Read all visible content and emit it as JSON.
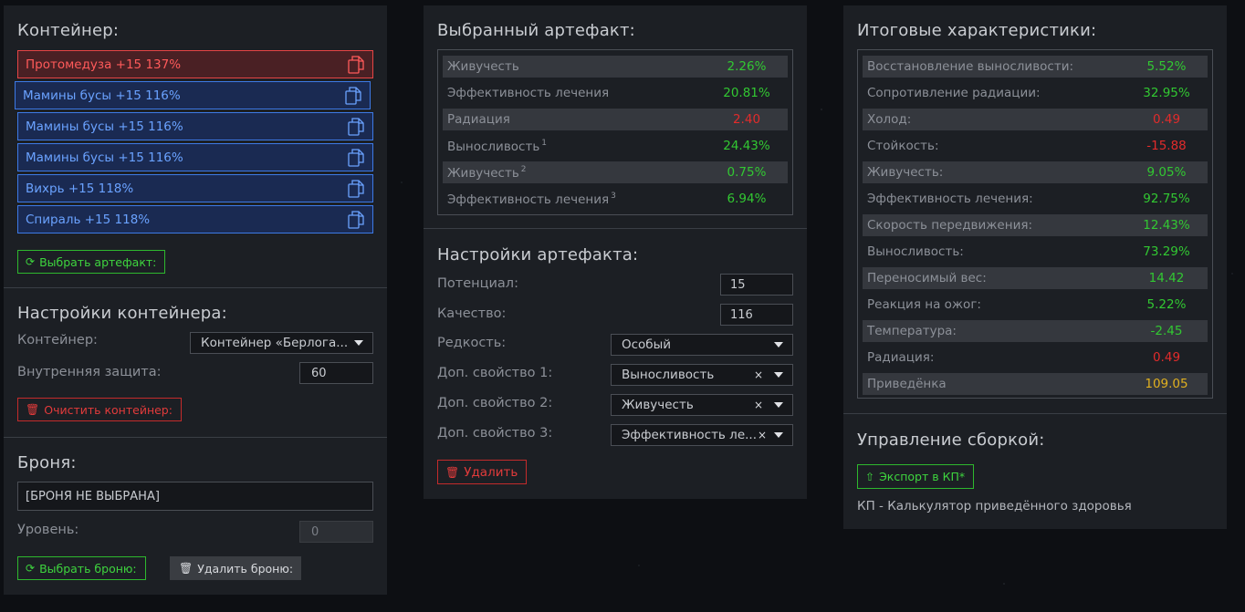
{
  "container_panel": {
    "title": "Контейнер:",
    "artifacts": [
      {
        "label": "Протомедуза +15 137%",
        "style": "red"
      },
      {
        "label": "Мамины бусы +15 116%",
        "style": "blue"
      },
      {
        "label": "Мамины бусы +15 116%",
        "style": "blue"
      },
      {
        "label": "Мамины бусы +15 116%",
        "style": "blue"
      },
      {
        "label": "Вихрь +15 118%",
        "style": "blue"
      },
      {
        "label": "Спираль +15 118%",
        "style": "blue"
      }
    ],
    "select_artifact_label": "Выбрать артефакт:",
    "settings_title": "Настройки контейнера:",
    "container_label": "Контейнер:",
    "container_value": "Контейнер «Берлога...",
    "inner_protection_label": "Внутренняя защита:",
    "inner_protection_value": "60",
    "clear_label": "Очистить контейнер:",
    "armor_title": "Броня:",
    "armor_value": "[БРОНЯ НЕ ВЫБРАНА]",
    "level_label": "Уровень:",
    "level_value": "0",
    "select_armor_label": "Выбрать броню:",
    "delete_armor_label": "Удалить броню:"
  },
  "artifact_panel": {
    "title": "Выбранный артефакт:",
    "stats": [
      {
        "name": "Живучесть",
        "sup": "",
        "value": "2.26%",
        "color": "green"
      },
      {
        "name": "Эффективность лечения",
        "sup": "",
        "value": "20.81%",
        "color": "green"
      },
      {
        "name": "Радиация",
        "sup": "",
        "value": "2.40",
        "color": "red"
      },
      {
        "name": "Выносливость",
        "sup": "1",
        "value": "24.43%",
        "color": "green"
      },
      {
        "name": "Живучесть",
        "sup": "2",
        "value": "0.75%",
        "color": "green"
      },
      {
        "name": "Эффективность лечения",
        "sup": "3",
        "value": "6.94%",
        "color": "green"
      }
    ],
    "settings_title": "Настройки артефакта:",
    "potential_label": "Потенциал:",
    "potential_value": "15",
    "quality_label": "Качество:",
    "quality_value": "116",
    "rarity_label": "Редкость:",
    "rarity_value": "Особый",
    "prop1_label": "Доп. свойство 1:",
    "prop1_value": "Выносливость",
    "prop2_label": "Доп. свойство 2:",
    "prop2_value": "Живучесть",
    "prop3_label": "Доп. свойство 3:",
    "prop3_value": "Эффективность ле...",
    "clear_x": "×",
    "delete_label": "Удалить"
  },
  "totals_panel": {
    "title": "Итоговые характеристики:",
    "stats": [
      {
        "name": "Восстановление выносливости:",
        "value": "5.52%",
        "color": "green"
      },
      {
        "name": "Сопротивление радиации:",
        "value": "32.95%",
        "color": "green"
      },
      {
        "name": "Холод:",
        "value": "0.49",
        "color": "red"
      },
      {
        "name": "Стойкость:",
        "value": "-15.88",
        "color": "red"
      },
      {
        "name": "Живучесть:",
        "value": "9.05%",
        "color": "green"
      },
      {
        "name": "Эффективность лечения:",
        "value": "92.75%",
        "color": "green"
      },
      {
        "name": "Скорость передвижения:",
        "value": "12.43%",
        "color": "green"
      },
      {
        "name": "Выносливость:",
        "value": "73.29%",
        "color": "green"
      },
      {
        "name": "Переносимый вес:",
        "value": "14.42",
        "color": "green"
      },
      {
        "name": "Реакция на ожог:",
        "value": "5.22%",
        "color": "green"
      },
      {
        "name": "Температура:",
        "value": "-2.45",
        "color": "green"
      },
      {
        "name": "Радиация:",
        "value": "0.49",
        "color": "red"
      },
      {
        "name": "Приведёнка",
        "value": "109.05",
        "color": "yellow"
      }
    ],
    "build_title": "Управление сборкой:",
    "export_label": "Экспорт в КП*",
    "footnote": "КП - Калькулятор приведённого здоровья"
  },
  "colors": {
    "green": "#32c832",
    "red": "#e22b2b",
    "yellow": "#e0b020",
    "blue_border": "#3d7ae6",
    "red_border": "#e64545"
  },
  "icons": {
    "copy": "copy-icon",
    "refresh": "refresh-icon",
    "trash": "trash-icon",
    "upload": "upload-icon",
    "caret": "chevron-down-icon",
    "clear": "close-icon"
  }
}
